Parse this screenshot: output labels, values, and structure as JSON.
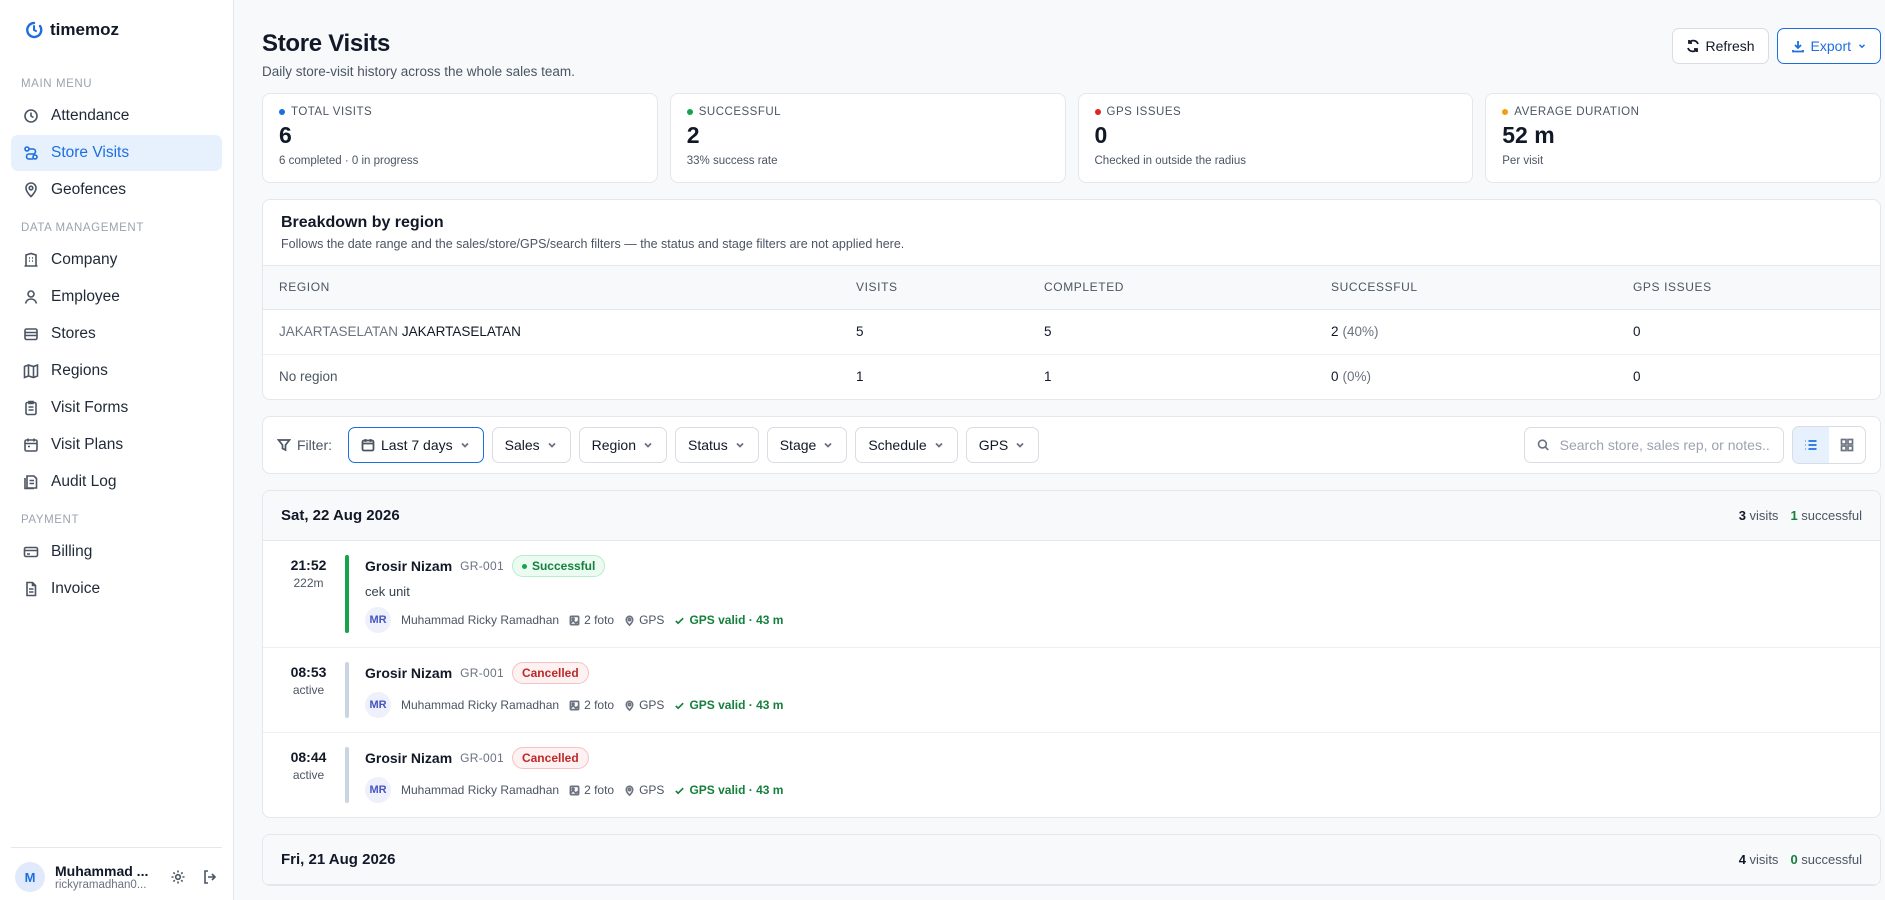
{
  "brand": {
    "name": "timemoz"
  },
  "sidebar": {
    "sections": [
      {
        "title": "MAIN MENU",
        "items": [
          {
            "label": "Attendance",
            "icon": "clock-icon"
          },
          {
            "label": "Store Visits",
            "icon": "route-icon",
            "active": true
          },
          {
            "label": "Geofences",
            "icon": "map-pin-icon"
          }
        ]
      },
      {
        "title": "DATA MANAGEMENT",
        "items": [
          {
            "label": "Company",
            "icon": "building-icon"
          },
          {
            "label": "Employee",
            "icon": "user-icon"
          },
          {
            "label": "Stores",
            "icon": "store-icon"
          },
          {
            "label": "Regions",
            "icon": "map-icon"
          },
          {
            "label": "Visit Forms",
            "icon": "clipboard-icon"
          },
          {
            "label": "Visit Plans",
            "icon": "calendar-icon"
          },
          {
            "label": "Audit Log",
            "icon": "log-icon"
          }
        ]
      },
      {
        "title": "PAYMENT",
        "items": [
          {
            "label": "Billing",
            "icon": "credit-card-icon"
          },
          {
            "label": "Invoice",
            "icon": "file-icon"
          }
        ]
      }
    ],
    "user": {
      "initial": "M",
      "name": "Muhammad ...",
      "email": "rickyramadhan0..."
    }
  },
  "header": {
    "title": "Store Visits",
    "subtitle": "Daily store-visit history across the whole sales team.",
    "refresh_label": "Refresh",
    "export_label": "Export"
  },
  "stats": [
    {
      "label": "TOTAL VISITS",
      "value": "6",
      "note": "6 completed · 0 in progress",
      "color": "#1d6fe0"
    },
    {
      "label": "SUCCESSFUL",
      "value": "2",
      "note": "33% success rate",
      "color": "#16a34a"
    },
    {
      "label": "GPS ISSUES",
      "value": "0",
      "note": "Checked in outside the radius",
      "color": "#dc2626"
    },
    {
      "label": "AVERAGE DURATION",
      "value": "52 m",
      "note": "Per visit",
      "color": "#f59e0b"
    }
  ],
  "regions": {
    "title": "Breakdown by region",
    "subtitle": "Follows the date range and the sales/store/GPS/search filters — the status and stage filters are not applied here.",
    "columns": [
      "REGION",
      "VISITS",
      "COMPLETED",
      "SUCCESSFUL",
      "GPS ISSUES"
    ],
    "rows": [
      {
        "region_code": "JAKARTASELATAN",
        "region_name": "JAKARTASELATAN",
        "visits": "5",
        "completed": "5",
        "successful": "2",
        "pct": "(40%)",
        "gps": "0"
      },
      {
        "region_code": "",
        "region_name": "No region",
        "visits": "1",
        "completed": "1",
        "successful": "0",
        "pct": "(0%)",
        "gps": "0"
      }
    ]
  },
  "filters": {
    "label": "Filter:",
    "date": "Last 7 days",
    "chips": [
      "Sales",
      "Region",
      "Status",
      "Stage",
      "Schedule",
      "GPS"
    ],
    "search_placeholder": "Search store, sales rep, or notes..."
  },
  "days": [
    {
      "title": "Sat, 22 Aug 2026",
      "visits_count": "3",
      "visits_word": "visits",
      "success_count": "1",
      "success_word": "successful",
      "visits": [
        {
          "time": "21:52",
          "dur": "222m",
          "store": "Grosir Nizam",
          "code": "GR-001",
          "status": "Successful",
          "status_type": "ok",
          "note": "cek unit",
          "rep_initials": "MR",
          "rep": "Muhammad Ricky Ramadhan",
          "photos": "2 foto",
          "gps": "GPS",
          "gps_valid": "GPS valid · 43 m",
          "bar_color": "#16a34a"
        },
        {
          "time": "08:53",
          "dur": "active",
          "store": "Grosir Nizam",
          "code": "GR-001",
          "status": "Cancelled",
          "status_type": "cancel",
          "note": "",
          "rep_initials": "MR",
          "rep": "Muhammad Ricky Ramadhan",
          "photos": "2 foto",
          "gps": "GPS",
          "gps_valid": "GPS valid · 43 m",
          "bar_color": "#cbd5e1"
        },
        {
          "time": "08:44",
          "dur": "active",
          "store": "Grosir Nizam",
          "code": "GR-001",
          "status": "Cancelled",
          "status_type": "cancel",
          "note": "",
          "rep_initials": "MR",
          "rep": "Muhammad Ricky Ramadhan",
          "photos": "2 foto",
          "gps": "GPS",
          "gps_valid": "GPS valid · 43 m",
          "bar_color": "#cbd5e1"
        }
      ]
    },
    {
      "title": "Fri, 21 Aug 2026",
      "visits_count": "4",
      "visits_word": "visits",
      "success_count": "0",
      "success_word": "successful",
      "visits": []
    }
  ]
}
